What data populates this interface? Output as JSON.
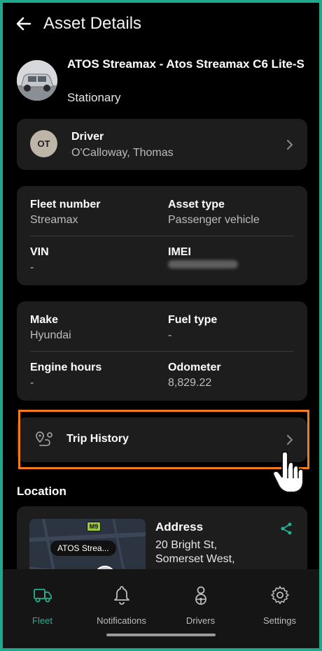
{
  "header": {
    "title": "Asset Details"
  },
  "asset": {
    "name": "ATOS Streamax - Atos Streamax C6 Lite-S",
    "status": "Stationary"
  },
  "driver": {
    "initials": "OT",
    "label": "Driver",
    "name": "O'Calloway, Thomas"
  },
  "details1": {
    "fleet_number_label": "Fleet number",
    "fleet_number": "Streamax",
    "asset_type_label": "Asset type",
    "asset_type": "Passenger vehicle",
    "vin_label": "VIN",
    "vin": "-",
    "imei_label": "IMEI"
  },
  "details2": {
    "make_label": "Make",
    "make": "Hyundai",
    "fuel_type_label": "Fuel type",
    "fuel_type": "-",
    "engine_hours_label": "Engine hours",
    "engine_hours": "-",
    "odometer_label": "Odometer",
    "odometer": "8,829.22"
  },
  "trip": {
    "label": "Trip History"
  },
  "location": {
    "title": "Location",
    "map_badge": "ATOS Strea...",
    "road_sign": "M9",
    "address_label": "Address",
    "address_line1": "20 Bright St,",
    "address_line2": "Somerset West,"
  },
  "nav": [
    {
      "label": "Fleet",
      "icon": "truck-icon",
      "active": true
    },
    {
      "label": "Notifications",
      "icon": "bell-icon",
      "active": false
    },
    {
      "label": "Drivers",
      "icon": "driver-icon",
      "active": false
    },
    {
      "label": "Settings",
      "icon": "gear-icon",
      "active": false
    }
  ],
  "colors": {
    "accent": "#22b38f",
    "highlight": "#f47a1a",
    "frame": "#1ea98c"
  }
}
